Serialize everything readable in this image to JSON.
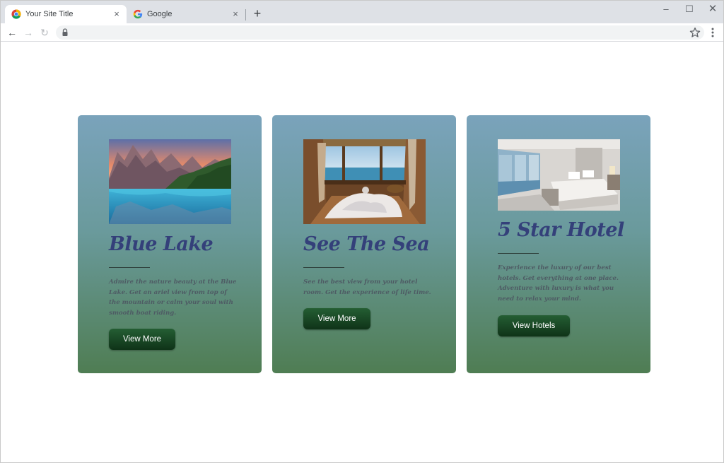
{
  "browser": {
    "tabs": [
      {
        "title": "Your Site Title",
        "close": "×"
      },
      {
        "title": "Google",
        "close": "×"
      }
    ],
    "new_tab": "+",
    "window_controls": {
      "minimize": "–",
      "maximize": "☐",
      "close": "✕"
    },
    "nav": {
      "back": "←",
      "forward": "→",
      "reload": "↻"
    },
    "address_value": "",
    "icons": [
      "chrome-icon",
      "google-icon",
      "lock-icon",
      "star-icon",
      "menu-icon"
    ]
  },
  "cards": [
    {
      "title": "Blue Lake",
      "description": "Admire the nature beauty at the Blue Lake. Get an ariel view from top of the mountain or calm your soul with smooth boat riding.",
      "button": "View More"
    },
    {
      "title": "See The Sea",
      "description": "See the best view from your hotel room. Get the experience of life time.",
      "button": "View More"
    },
    {
      "title": "5 Star Hotel",
      "description": "Experience the luxury of our best hotels. Get everything at one place. Adventure with luxury is what you need to relax your mind.",
      "button": "View Hotels"
    }
  ],
  "colors": {
    "card_top": "#7aa3bb",
    "card_bottom": "#4f7d53",
    "title": "#34407a",
    "button": "#1a4a28"
  }
}
